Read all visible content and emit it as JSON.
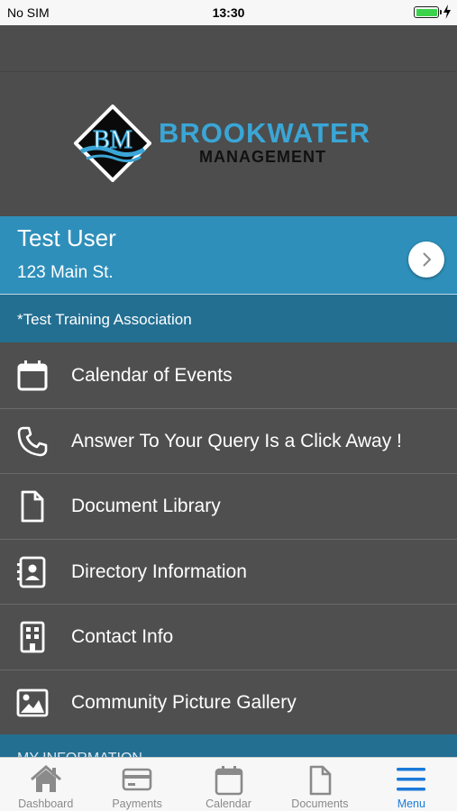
{
  "status_bar": {
    "carrier": "No SIM",
    "time": "13:30"
  },
  "branding": {
    "title": "BROOKWATER",
    "subtitle": "MANAGEMENT",
    "monogram": "BM"
  },
  "profile": {
    "name": "Test User",
    "address": "123 Main St."
  },
  "association": {
    "label": "*Test Training Association"
  },
  "menu": [
    {
      "label": "Calendar of Events",
      "icon": "calendar-icon"
    },
    {
      "label": "Answer To Your Query Is a Click Away !",
      "icon": "phone-icon"
    },
    {
      "label": "Document Library",
      "icon": "document-icon"
    },
    {
      "label": "Directory Information",
      "icon": "contact-card-icon"
    },
    {
      "label": "Contact Info",
      "icon": "building-icon"
    },
    {
      "label": "Community Picture Gallery",
      "icon": "image-icon"
    }
  ],
  "section": {
    "label": "MY INFORMATION"
  },
  "tabs": [
    {
      "label": "Dashboard",
      "icon": "home-icon"
    },
    {
      "label": "Payments",
      "icon": "credit-card-icon"
    },
    {
      "label": "Calendar",
      "icon": "calendar-icon"
    },
    {
      "label": "Documents",
      "icon": "document-icon"
    },
    {
      "label": "Menu",
      "icon": "hamburger-menu-icon",
      "active": true
    }
  ],
  "colors": {
    "brand_blue": "#3aa6d6",
    "profile_bg": "#2e8fba",
    "association_bg": "#236f92",
    "active_tab": "#1b7ad9",
    "battery": "#3cd34c"
  }
}
